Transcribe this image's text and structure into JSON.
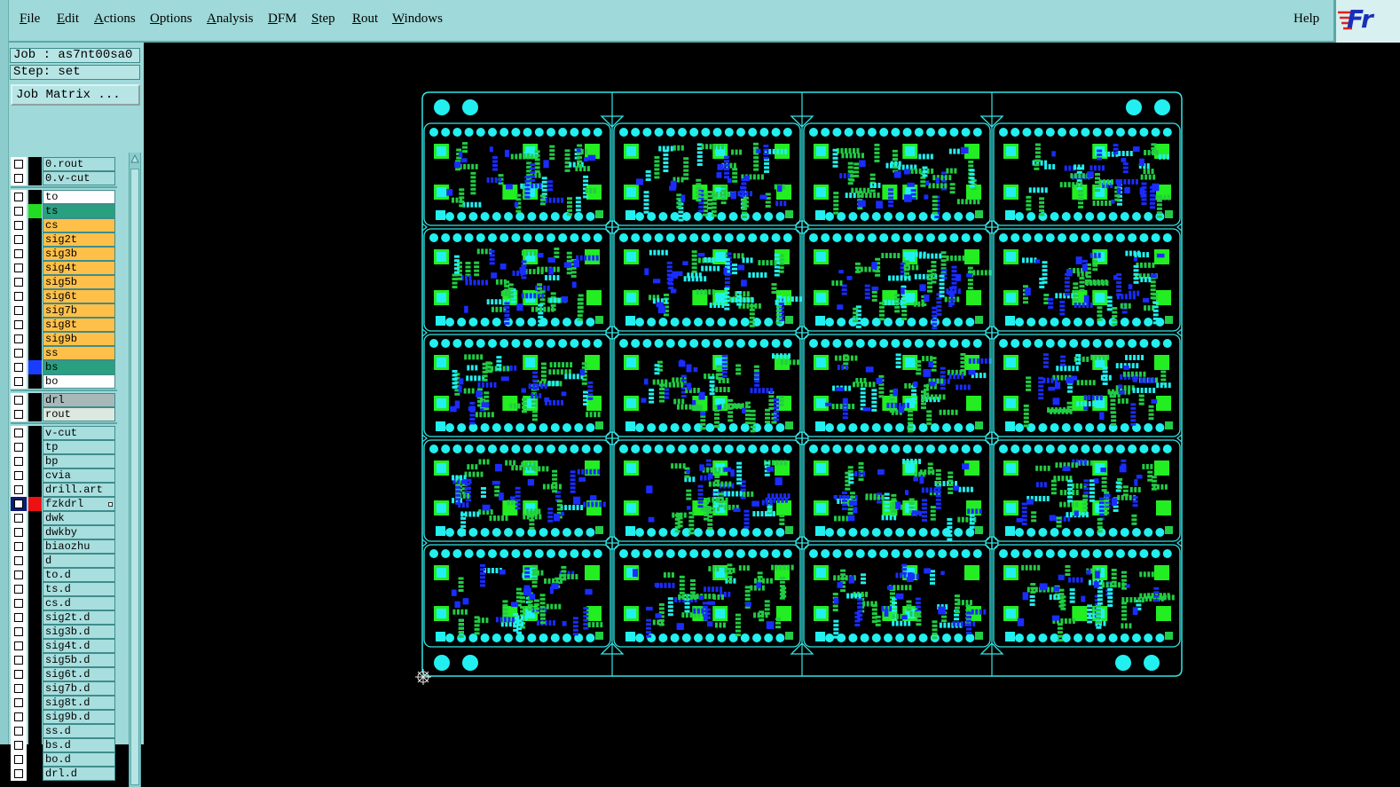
{
  "menubar": {
    "items": [
      "File",
      "Edit",
      "Actions",
      "Options",
      "Analysis",
      "DFM",
      "Step",
      "Rout",
      "Windows"
    ],
    "underline": [
      "F",
      "E",
      "A",
      "O",
      "A",
      "D",
      "S",
      "R",
      "W"
    ],
    "help": "Help",
    "logo": "Fr"
  },
  "panel": {
    "job": "Job : as7nt00sa0",
    "step": "Step: set",
    "job_matrix": "Job Matrix ..."
  },
  "layers": [
    {
      "name": "0.rout",
      "bg": "#a8dede",
      "swatch": "#000000"
    },
    {
      "name": "0.v-cut",
      "bg": "#a8dede",
      "swatch": "#000000"
    },
    {
      "name": "to",
      "bg": "#ffffff",
      "swatch": "#000000"
    },
    {
      "name": "ts",
      "bg": "#2aa080",
      "swatch": "#22dd22"
    },
    {
      "name": "cs",
      "bg": "#ffc04a",
      "swatch": "#000000"
    },
    {
      "name": "sig2t",
      "bg": "#ffc04a",
      "swatch": "#000000"
    },
    {
      "name": "sig3b",
      "bg": "#ffc04a",
      "swatch": "#000000"
    },
    {
      "name": "sig4t",
      "bg": "#ffc04a",
      "swatch": "#000000"
    },
    {
      "name": "sig5b",
      "bg": "#ffc04a",
      "swatch": "#000000"
    },
    {
      "name": "sig6t",
      "bg": "#ffc04a",
      "swatch": "#000000"
    },
    {
      "name": "sig7b",
      "bg": "#ffc04a",
      "swatch": "#000000"
    },
    {
      "name": "sig8t",
      "bg": "#ffc04a",
      "swatch": "#000000"
    },
    {
      "name": "sig9b",
      "bg": "#ffc04a",
      "swatch": "#000000"
    },
    {
      "name": "ss",
      "bg": "#ffc04a",
      "swatch": "#000000"
    },
    {
      "name": "bs",
      "bg": "#2aa080",
      "swatch": "#1a3cff"
    },
    {
      "name": "bo",
      "bg": "#ffffff",
      "swatch": "#000000"
    },
    {
      "name": "drl",
      "bg": "#a8b8b8",
      "swatch": "#000000"
    },
    {
      "name": "rout",
      "bg": "#dde8e0",
      "swatch": "#000000"
    },
    {
      "name": "v-cut",
      "bg": "#a8dede",
      "swatch": "#000000"
    },
    {
      "name": "tp",
      "bg": "#a8dede",
      "swatch": "#000000"
    },
    {
      "name": "bp",
      "bg": "#a8dede",
      "swatch": "#000000"
    },
    {
      "name": "cvia",
      "bg": "#a8dede",
      "swatch": "#000000"
    },
    {
      "name": "drill.art",
      "bg": "#a8dede",
      "swatch": "#000000"
    },
    {
      "name": "fzkdrl",
      "bg": "#a8dede",
      "swatch": "#ee1111",
      "selected": true
    },
    {
      "name": "dwk",
      "bg": "#a8dede",
      "swatch": "#000000"
    },
    {
      "name": "dwkby",
      "bg": "#a8dede",
      "swatch": "#000000"
    },
    {
      "name": "biaozhu",
      "bg": "#a8dede",
      "swatch": "#000000"
    },
    {
      "name": "d",
      "bg": "#a8dede",
      "swatch": "#000000"
    },
    {
      "name": "to.d",
      "bg": "#a8dede",
      "swatch": "#000000"
    },
    {
      "name": "ts.d",
      "bg": "#a8dede",
      "swatch": "#000000"
    },
    {
      "name": "cs.d",
      "bg": "#a8dede",
      "swatch": "#000000"
    },
    {
      "name": "sig2t.d",
      "bg": "#a8dede",
      "swatch": "#000000"
    },
    {
      "name": "sig3b.d",
      "bg": "#a8dede",
      "swatch": "#000000"
    },
    {
      "name": "sig4t.d",
      "bg": "#a8dede",
      "swatch": "#000000"
    },
    {
      "name": "sig5b.d",
      "bg": "#a8dede",
      "swatch": "#000000"
    },
    {
      "name": "sig6t.d",
      "bg": "#a8dede",
      "swatch": "#000000"
    },
    {
      "name": "sig7b.d",
      "bg": "#a8dede",
      "swatch": "#000000"
    },
    {
      "name": "sig8t.d",
      "bg": "#a8dede",
      "swatch": "#000000"
    },
    {
      "name": "sig9b.d",
      "bg": "#a8dede",
      "swatch": "#000000"
    },
    {
      "name": "ss.d",
      "bg": "#a8dede",
      "swatch": "#000000"
    },
    {
      "name": "bs.d",
      "bg": "#a8dede",
      "swatch": "#000000"
    },
    {
      "name": "bo.d",
      "bg": "#a8dede",
      "swatch": "#000000"
    },
    {
      "name": "drl.d",
      "bg": "#a8dede",
      "swatch": "#000000"
    }
  ],
  "colors": {
    "outline": "#33e6e6",
    "pad_cyan": "#22f0f0",
    "pad_green": "#22cc44",
    "bright_green": "#22ee22",
    "pad_blue": "#1a2cff"
  },
  "board": {
    "panel_cols": 4,
    "panel_rows": 5
  }
}
